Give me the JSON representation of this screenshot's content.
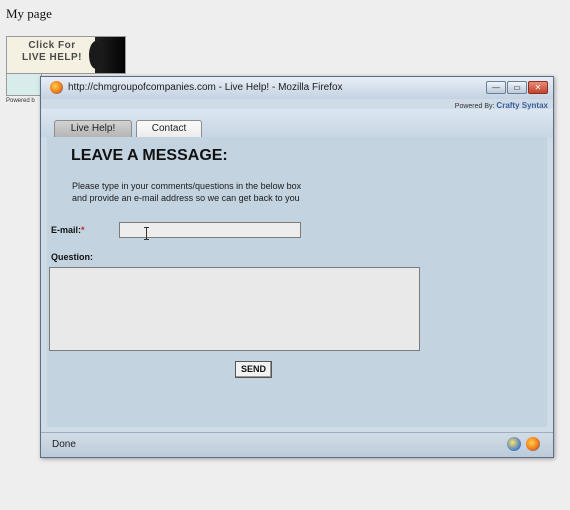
{
  "page": {
    "title": "My page",
    "banner": {
      "text_line1": "Click For",
      "text_line2": "LIVE HELP!"
    },
    "powered_small": "Powered b"
  },
  "window": {
    "title": "http://chmgroupofcompanies.com - Live Help! - Mozilla Firefox",
    "buttons": {
      "minimize": "—",
      "maximize": "▭",
      "close": "✕"
    },
    "powered_by_prefix": "Powered By:",
    "powered_by_name": "Crafty Syntax"
  },
  "tabs": [
    {
      "label": "Live Help!"
    },
    {
      "label": "Contact"
    }
  ],
  "form": {
    "heading": "LEAVE A MESSAGE:",
    "instructions_line1": "Please type in your comments/questions in the below box",
    "instructions_line2": "and provide an e-mail address so we can get back to you",
    "email_label": "E-mail:",
    "email_required_mark": "*",
    "email_value": "",
    "question_label": "Question:",
    "question_value": "",
    "send_label": "SEND"
  },
  "status": {
    "text": "Done"
  },
  "icons": {
    "titlebar": "firefox-icon",
    "status_a": "status-network-icon",
    "status_b": "status-firefox-icon"
  }
}
